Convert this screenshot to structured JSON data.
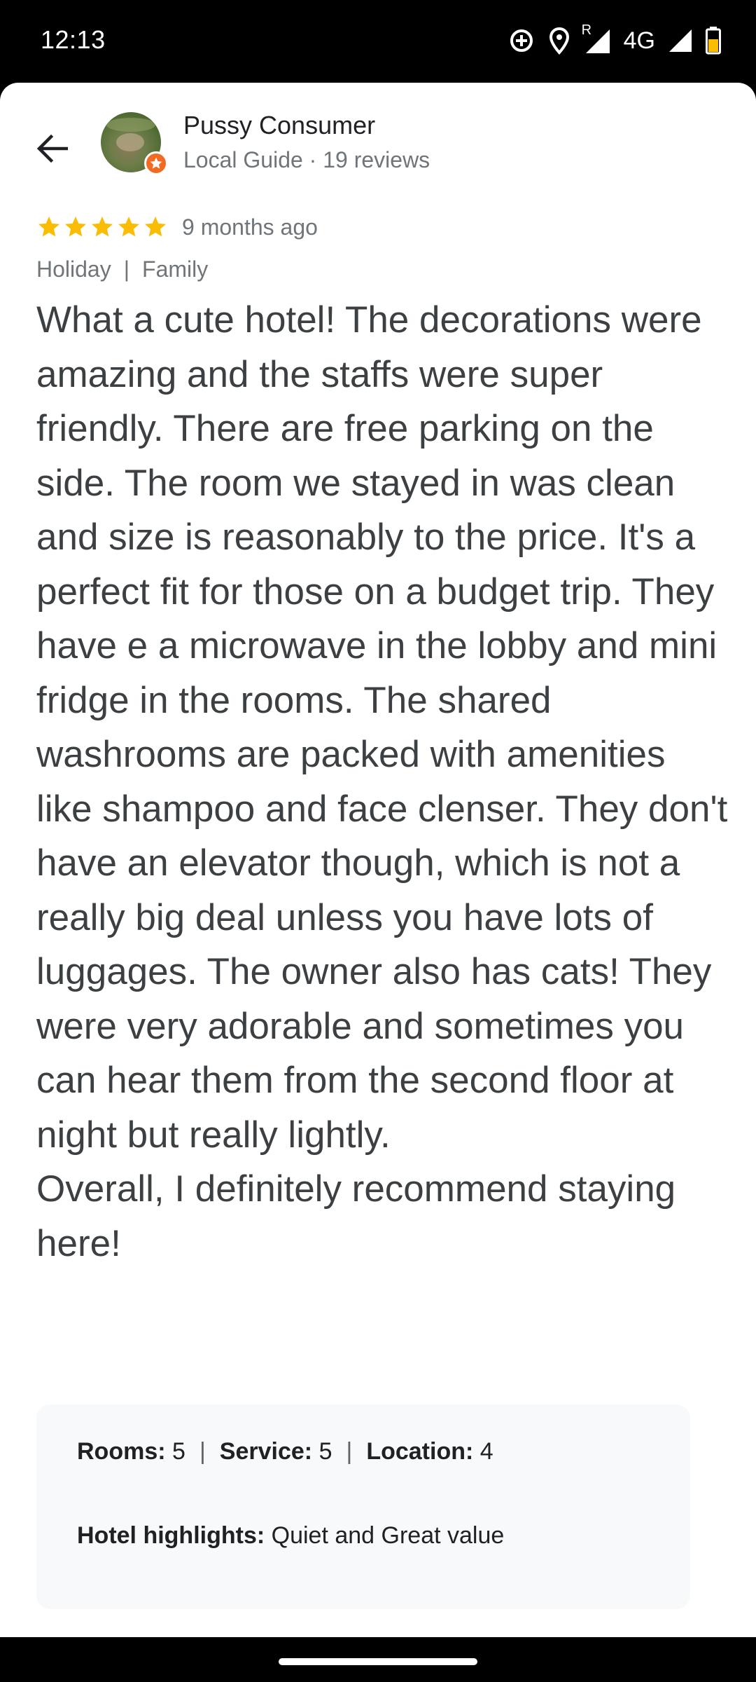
{
  "status_bar": {
    "time": "12:13",
    "network_label": "4G",
    "roaming_label": "R",
    "icons": [
      "data-saver-icon",
      "location-icon",
      "signal-roaming-icon",
      "signal-icon",
      "battery-icon"
    ]
  },
  "review": {
    "author_name": "Pussy Consumer",
    "author_meta": "Local Guide · 19 reviews",
    "rating": 5,
    "rating_max": 5,
    "time_ago": "9 months ago",
    "trip_type": "Holiday",
    "trip_party": "Family",
    "trip_separator": "|",
    "text": "What a cute hotel! The decorations were amazing and the staffs were super friendly. There are free parking on the side. The room we stayed in was clean and size is reasonably to the price. It's a perfect fit for those on a budget trip. They have e a microwave in the lobby and mini fridge in the rooms. The shared washrooms are packed with amenities like shampoo and face clenser. They don't have an elevator though, which is not a really big deal unless you have lots of luggages. The owner also has cats! They were very adorable and sometimes you can hear them from the second floor at night but really lightly.\nOverall, I definitely recommend staying here!",
    "sub_ratings": {
      "rooms_label": "Rooms:",
      "rooms_value": "5",
      "service_label": "Service:",
      "service_value": "5",
      "location_label": "Location:",
      "location_value": "4",
      "separator": "|"
    },
    "highlights_label": "Hotel highlights:",
    "highlights_value": "Quiet and Great value"
  },
  "colors": {
    "star": "#fbbc04",
    "badge": "#f26b22",
    "secondary_text": "#70757a",
    "body_text": "#3c4043",
    "box_bg": "#f8f9fa"
  }
}
